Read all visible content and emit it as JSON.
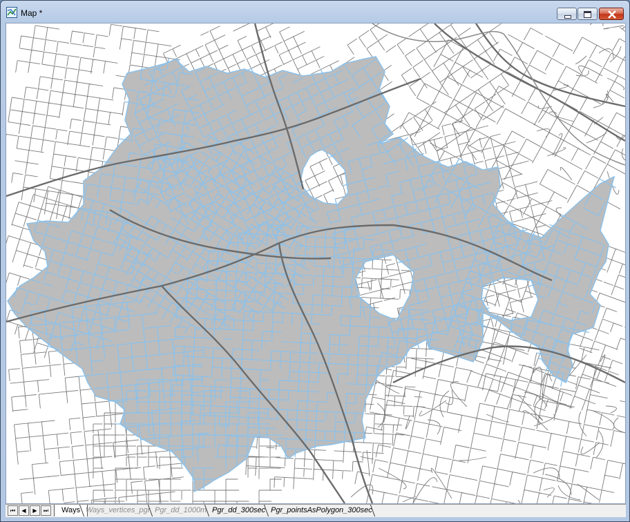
{
  "window": {
    "title": "Map *",
    "app_icon": "map-icon",
    "controls": [
      "minimize-icon",
      "maximize-icon",
      "close-icon"
    ]
  },
  "map": {
    "description_layer_colors": {
      "background": "#ffffff",
      "street_lines": "#777777",
      "service_area_fill": "#bdbdbd",
      "service_area_outline": "#86bde6"
    },
    "layers_visible": [
      "Ways",
      "Pgr_pointsAsPolygon_300sec"
    ]
  },
  "tabbar": {
    "nav": [
      "first-icon",
      "prev-icon",
      "next-icon",
      "last-icon"
    ],
    "tabs": [
      {
        "label": "Ways",
        "state": "active"
      },
      {
        "label": "Ways_vertices_pgr",
        "state": "disabled"
      },
      {
        "label": "Pgr_dd_1000m",
        "state": "disabled"
      },
      {
        "label": "Pgr_dd_300sec",
        "state": "normal"
      },
      {
        "label": "Pgr_pointsAsPolygon_300sec",
        "state": "normal"
      }
    ]
  }
}
